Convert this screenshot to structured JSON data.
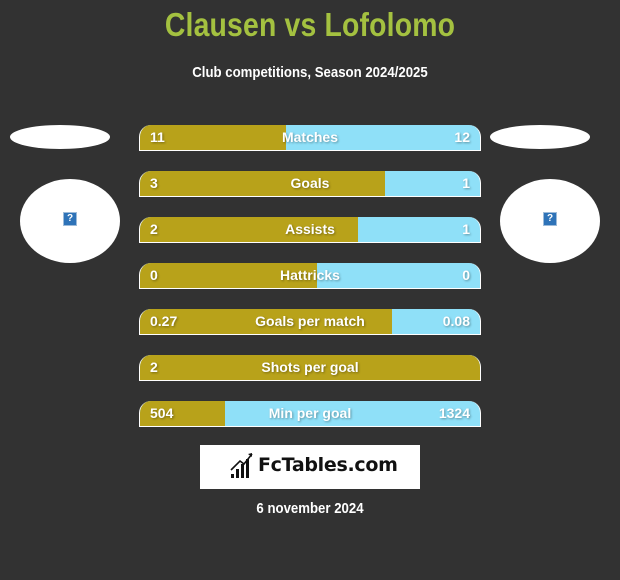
{
  "header": {
    "title": "Clausen vs Lofolomo",
    "subtitle": "Club competitions, Season 2024/2025"
  },
  "teams": {
    "left": {
      "name": "Clausen",
      "logo_icon": "missing-image-icon",
      "logo_glyph": "?"
    },
    "right": {
      "name": "Lofolomo",
      "logo_icon": "missing-image-icon",
      "logo_glyph": "?"
    }
  },
  "colors": {
    "background": "#323232",
    "title": "#a4c140",
    "left_bar": "#b8a21a",
    "right_bar": "#8fe0f8",
    "text": "#ffffff"
  },
  "stats": [
    {
      "label": "Matches",
      "left": "11",
      "right": "12",
      "left_share": 0.43
    },
    {
      "label": "Goals",
      "left": "3",
      "right": "1",
      "left_share": 0.72
    },
    {
      "label": "Assists",
      "left": "2",
      "right": "1",
      "left_share": 0.64
    },
    {
      "label": "Hattricks",
      "left": "0",
      "right": "0",
      "left_share": 0.52
    },
    {
      "label": "Goals per match",
      "left": "0.27",
      "right": "0.08",
      "left_share": 0.74
    },
    {
      "label": "Shots per goal",
      "left": "2",
      "right": "",
      "left_share": 1.0
    },
    {
      "label": "Min per goal",
      "left": "504",
      "right": "1324",
      "left_share": 0.25
    }
  ],
  "brand": {
    "name": "FcTables.com",
    "icon": "bar-chart-icon"
  },
  "footer": {
    "date": "6 november 2024"
  }
}
